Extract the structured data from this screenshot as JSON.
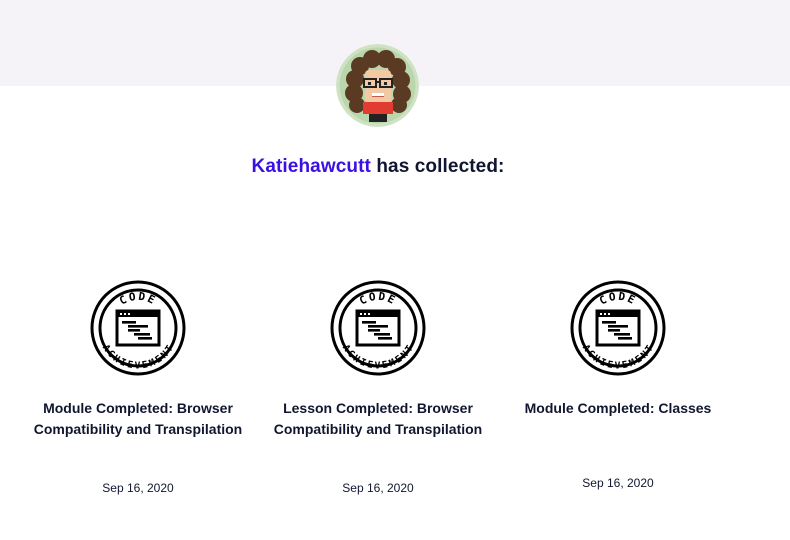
{
  "profile": {
    "username": "Katiehawcutt",
    "collected_text": " has collected:"
  },
  "badges": [
    {
      "icon_top": "CODE",
      "icon_bottom": "ACHIEVEMENT",
      "title": "Module Completed: Browser Compatibility and Transpilation",
      "date": "Sep 16, 2020"
    },
    {
      "icon_top": "CODE",
      "icon_bottom": "ACHIEVEMENT",
      "title": "Lesson Completed: Browser Compatibility and Transpilation",
      "date": "Sep 16, 2020"
    },
    {
      "icon_top": "CODE",
      "icon_bottom": "ACHIEVEMENT",
      "title": "Module Completed: Classes",
      "date": "Sep 16, 2020"
    }
  ]
}
